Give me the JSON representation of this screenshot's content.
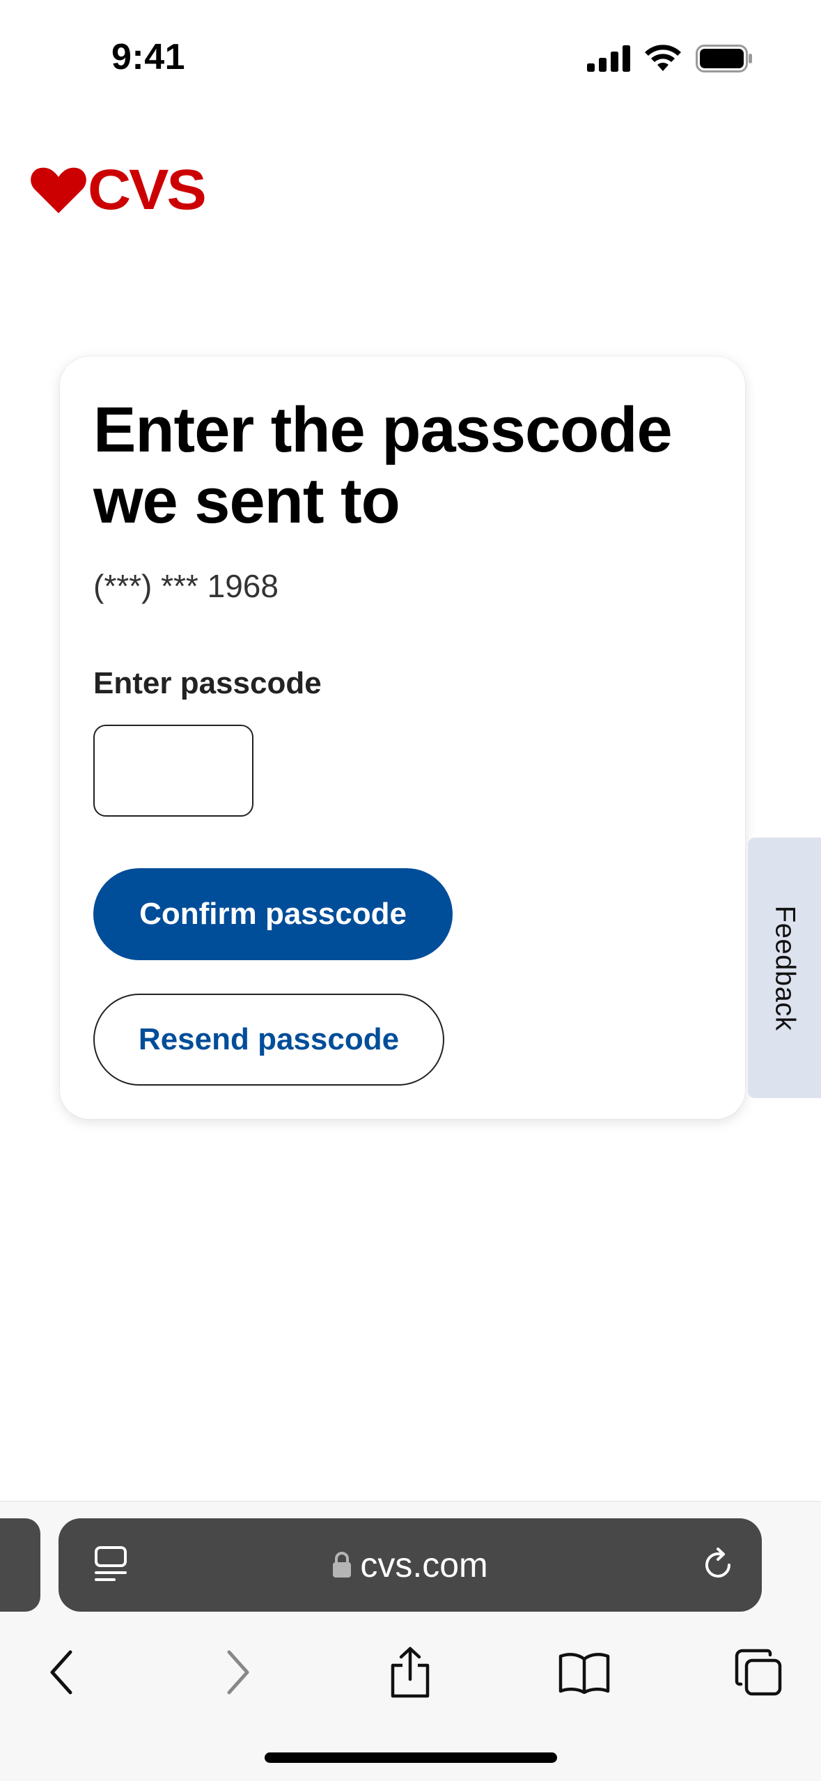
{
  "status_bar": {
    "time": "9:41",
    "icons": [
      "cellular-signal-icon",
      "wifi-icon",
      "battery-icon"
    ]
  },
  "logo": {
    "text": "CVS",
    "icon": "heart-icon",
    "color": "#cc0000"
  },
  "card": {
    "heading": "Enter the passcode we sent to",
    "masked_phone": "(***) *** 1968",
    "passcode_label": "Enter passcode",
    "passcode_value": "",
    "confirm_label": "Confirm passcode",
    "resend_label": "Resend passcode"
  },
  "feedback": {
    "label": "Feedback"
  },
  "browser": {
    "url": "cvs.com",
    "icons": {
      "page_menu": "page-menu-icon",
      "lock": "lock-icon",
      "reload": "reload-icon",
      "back": "back-icon",
      "forward": "forward-icon",
      "share": "share-icon",
      "bookmarks": "bookmarks-icon",
      "tabs": "tabs-icon"
    }
  },
  "colors": {
    "brand_red": "#cc0000",
    "primary_blue": "#004d99",
    "feedback_bg": "#dde3ee",
    "url_bar_bg": "#484848"
  }
}
